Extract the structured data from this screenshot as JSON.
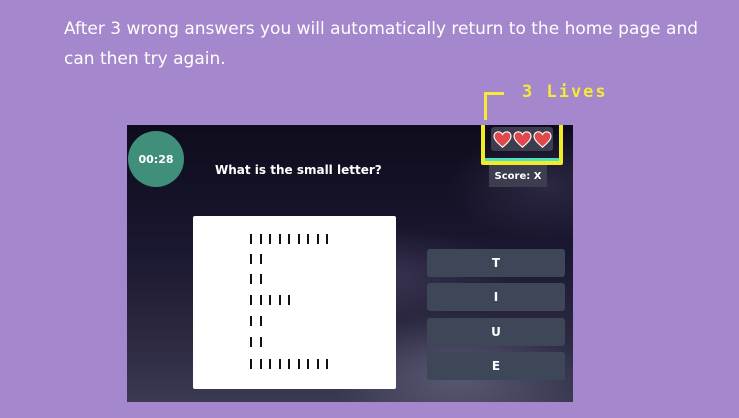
{
  "instructions": "After 3 wrong answers you will automatically return to the home page and can then try again.",
  "lives_label": "3 Lives",
  "game": {
    "timer": "00:28",
    "question": "What is the small letter?",
    "lives": 3,
    "score_label": "Score: X",
    "answers": [
      "T",
      "I",
      "U",
      "E"
    ]
  },
  "colors": {
    "background": "#a487cc",
    "callout": "#f5e93a",
    "timer": "#3f8f7b",
    "heart": "#e0484c",
    "answer_button": "#3e4758"
  },
  "icons": [
    "heart-icon",
    "heart-icon",
    "heart-icon"
  ]
}
